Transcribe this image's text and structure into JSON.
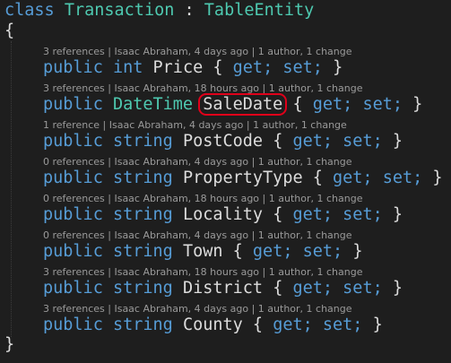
{
  "class_decl": {
    "keyword": "class",
    "name": "Transaction",
    "colon": ":",
    "base": "TableEntity",
    "open_brace": "{",
    "close_brace": "}"
  },
  "common": {
    "modifier": "public",
    "open": "{",
    "get": "get;",
    "set": "set;",
    "close": "}"
  },
  "members": [
    {
      "lens": {
        "refs": "3 references",
        "author": "Isaac Abraham, 4 days ago",
        "changes": "1 author, 1 change"
      },
      "type": "int",
      "name": "Price"
    },
    {
      "lens": {
        "refs": "3 references",
        "author": "Isaac Abraham, 18 hours ago",
        "changes": "1 author, 1 change"
      },
      "type": "DateTime",
      "name": "SaleDate"
    },
    {
      "lens": {
        "refs": "1 reference",
        "author": "Isaac Abraham, 4 days ago",
        "changes": "1 author, 1 change"
      },
      "type": "string",
      "name": "PostCode"
    },
    {
      "lens": {
        "refs": "0 references",
        "author": "Isaac Abraham, 4 days ago",
        "changes": "1 author, 1 change"
      },
      "type": "string",
      "name": "PropertyType"
    },
    {
      "lens": {
        "refs": "0 references",
        "author": "Isaac Abraham, 18 hours ago",
        "changes": "1 author, 1 change"
      },
      "type": "string",
      "name": "Locality"
    },
    {
      "lens": {
        "refs": "0 references",
        "author": "Isaac Abraham, 4 days ago",
        "changes": "1 author, 1 change"
      },
      "type": "string",
      "name": "Town"
    },
    {
      "lens": {
        "refs": "3 references",
        "author": "Isaac Abraham, 18 hours ago",
        "changes": "1 author, 1 change"
      },
      "type": "string",
      "name": "District"
    },
    {
      "lens": {
        "refs": "3 references",
        "author": "Isaac Abraham, 4 days ago",
        "changes": "1 author, 1 change"
      },
      "type": "string",
      "name": "County"
    }
  ],
  "sep": "|",
  "colors": {
    "background": "#1e1e1e",
    "keyword": "#569cd6",
    "type": "#4ec9b0",
    "text": "#dcdcdc",
    "codelens": "#9a9a9a",
    "highlight": "#e0001a"
  }
}
